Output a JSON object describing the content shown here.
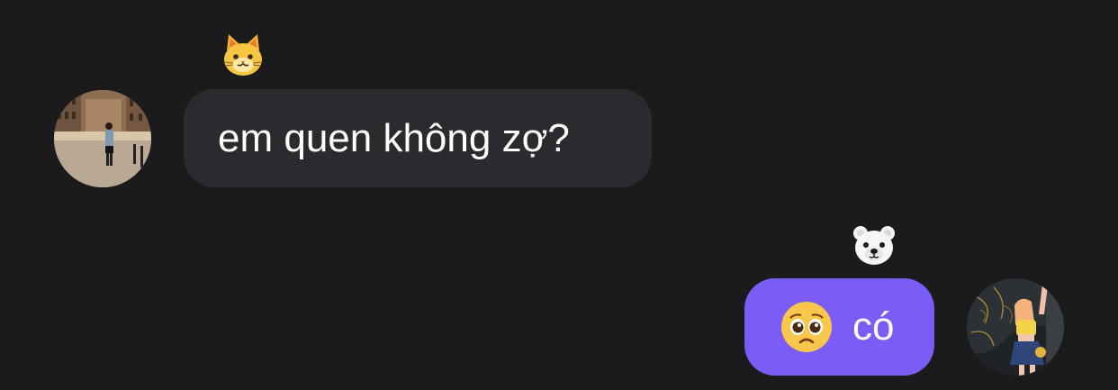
{
  "conversation": {
    "messages": [
      {
        "direction": "incoming",
        "text": "em quen không zợ?",
        "reaction_icon": "cat-face-icon"
      },
      {
        "direction": "outgoing",
        "text": "có",
        "leading_emoji_icon": "pleading-face-icon",
        "reaction_icon": "polar-bear-face-icon"
      }
    ]
  },
  "colors": {
    "background": "#1b1b1e",
    "incoming_bubble": "#2b2b2f",
    "outgoing_bubble": "#7b5cf7",
    "text": "#ffffff"
  }
}
